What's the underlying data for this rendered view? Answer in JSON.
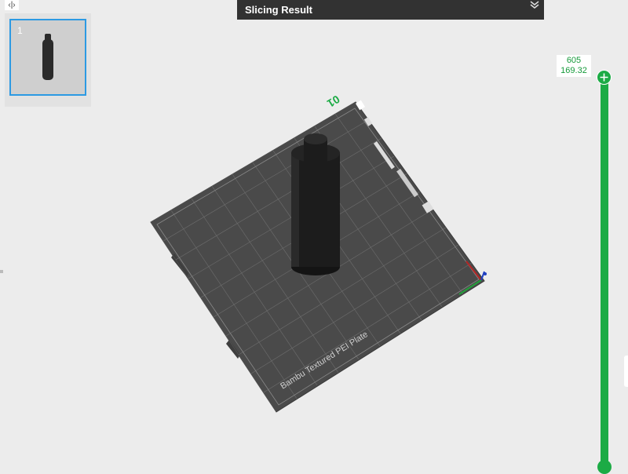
{
  "toolbar": {
    "toggle_icon": "‹|›"
  },
  "plates": {
    "items": [
      {
        "number": "1"
      }
    ]
  },
  "slicing": {
    "title": "Slicing Result",
    "collapse_icon": "chevron-double-down-icon"
  },
  "bed": {
    "name": "Bambu Textured PEI Plate",
    "plate_number": "01"
  },
  "layer_slider": {
    "layer": "605",
    "height": "169.32"
  },
  "colors": {
    "accent_green": "#1cab45",
    "selection_blue": "#2c9ae3",
    "header_bg": "#323232"
  }
}
